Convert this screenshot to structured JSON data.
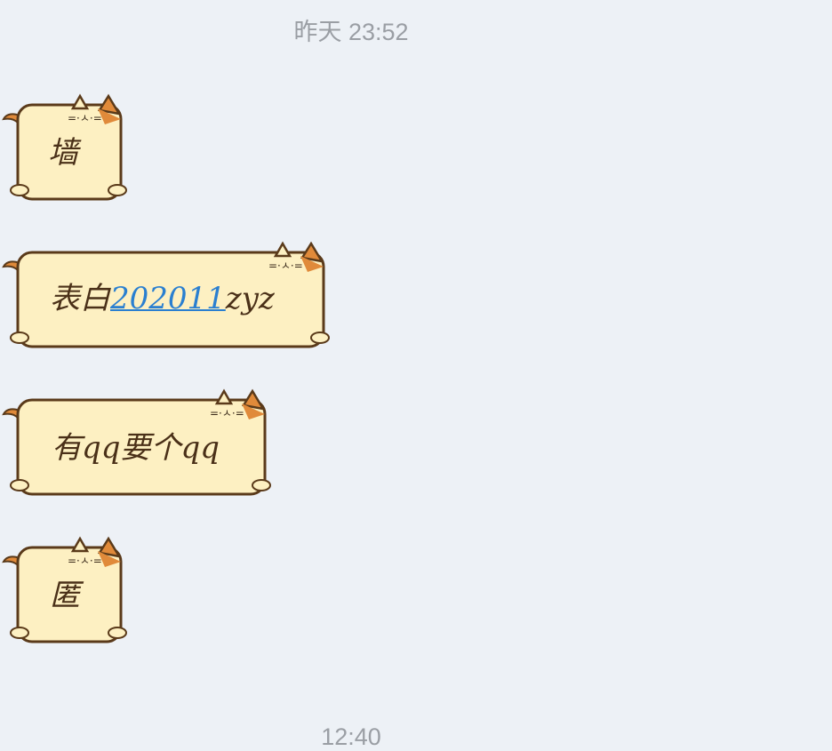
{
  "timestamps": {
    "first": "昨天 23:52",
    "second": "12:40"
  },
  "messages": [
    {
      "text": "墙"
    },
    {
      "text_prefix": "表白",
      "link": "202011",
      "text_suffix": "zyz"
    },
    {
      "text": "有qq要个qq"
    },
    {
      "text": "匿"
    }
  ],
  "colors": {
    "background": "#edf1f6",
    "bubble_fill": "#fdf0c2",
    "bubble_outline": "#5a3a1a",
    "cat_ear": "#e08a3a",
    "link": "#2a7fd0"
  }
}
